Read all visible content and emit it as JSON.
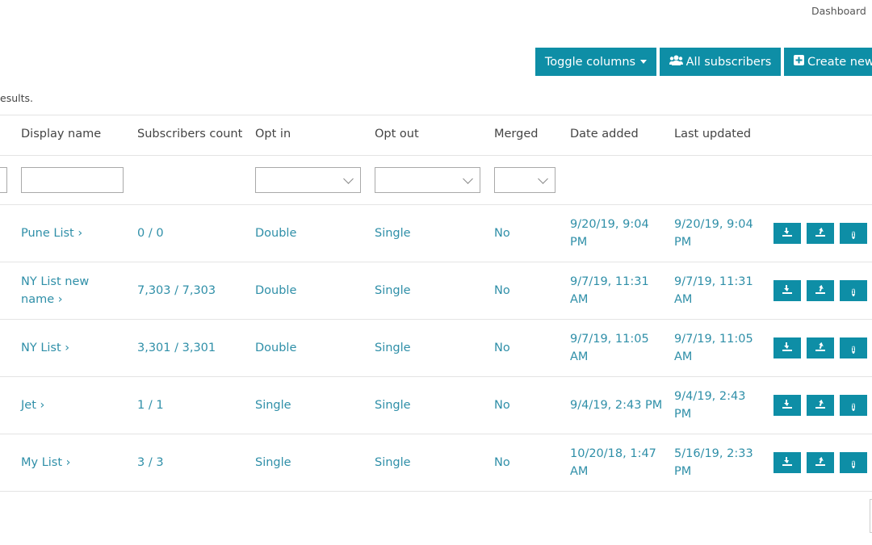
{
  "breadcrumb": {
    "current": "Dashboard"
  },
  "toolbar": {
    "toggle_columns_label": "Toggle columns",
    "all_subscribers_label": "All subscribers",
    "create_new_label": "Create new"
  },
  "summary": {
    "text": "esults."
  },
  "table": {
    "columns": [
      "Display name",
      "Subscribers count",
      "Opt in",
      "Opt out",
      "Merged",
      "Date added",
      "Last updated"
    ],
    "rows": [
      {
        "name": "Pune List",
        "count": "0 / 0",
        "opt_in": "Double",
        "opt_out": "Single",
        "merged": "No",
        "date_added": "9/20/19, 9:04 PM",
        "last_updated": "9/20/19, 9:04 PM"
      },
      {
        "name": "NY List new name",
        "count": "7,303 / 7,303",
        "opt_in": "Double",
        "opt_out": "Single",
        "merged": "No",
        "date_added": "9/7/19, 11:31 AM",
        "last_updated": "9/7/19, 11:31 AM"
      },
      {
        "name": "NY List",
        "count": "3,301 / 3,301",
        "opt_in": "Double",
        "opt_out": "Single",
        "merged": "No",
        "date_added": "9/7/19, 11:05 AM",
        "last_updated": "9/7/19, 11:05 AM"
      },
      {
        "name": "Jet",
        "count": "1 / 1",
        "opt_in": "Single",
        "opt_out": "Single",
        "merged": "No",
        "date_added": "9/4/19, 2:43 PM",
        "last_updated": "9/4/19, 2:43 PM"
      },
      {
        "name": "My List",
        "count": "3 / 3",
        "opt_in": "Single",
        "opt_out": "Single",
        "merged": "No",
        "date_added": "10/20/18, 1:47 AM",
        "last_updated": "5/16/19, 2:33 PM"
      }
    ]
  },
  "icons": {
    "toggle_caret": "caret-down-icon",
    "all_subscribers": "users-icon",
    "create_new": "plus-square-icon",
    "row_actions": [
      "import-icon",
      "export-icon",
      "info-icon",
      "more-icon"
    ]
  },
  "colors": {
    "accent": "#0e8ea6",
    "link": "#2f8fa8",
    "border": "#e4e4e4"
  }
}
